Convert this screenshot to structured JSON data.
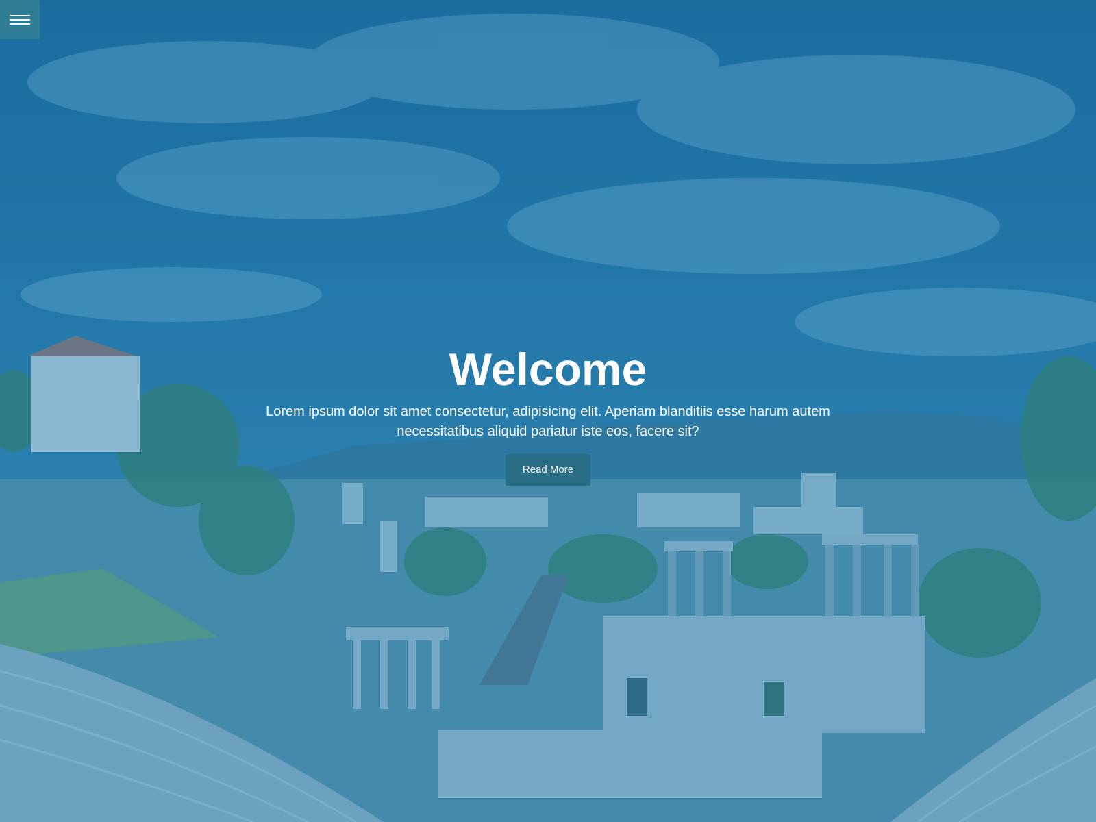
{
  "hero": {
    "title": "Welcome",
    "subtitle": "Lorem ipsum dolor sit amet consectetur, adipisicing elit. Aperiam blanditiis esse harum autem necessitatibus aliquid pariatur iste eos, facere sit?",
    "button_label": "Read More"
  },
  "icons": {
    "menu": "hamburger-menu-icon"
  },
  "colors": {
    "overlay": "#1f6e9a",
    "menu_button": "#2f7d95",
    "read_more_button": "#2a6e85",
    "text": "#ffffff"
  }
}
